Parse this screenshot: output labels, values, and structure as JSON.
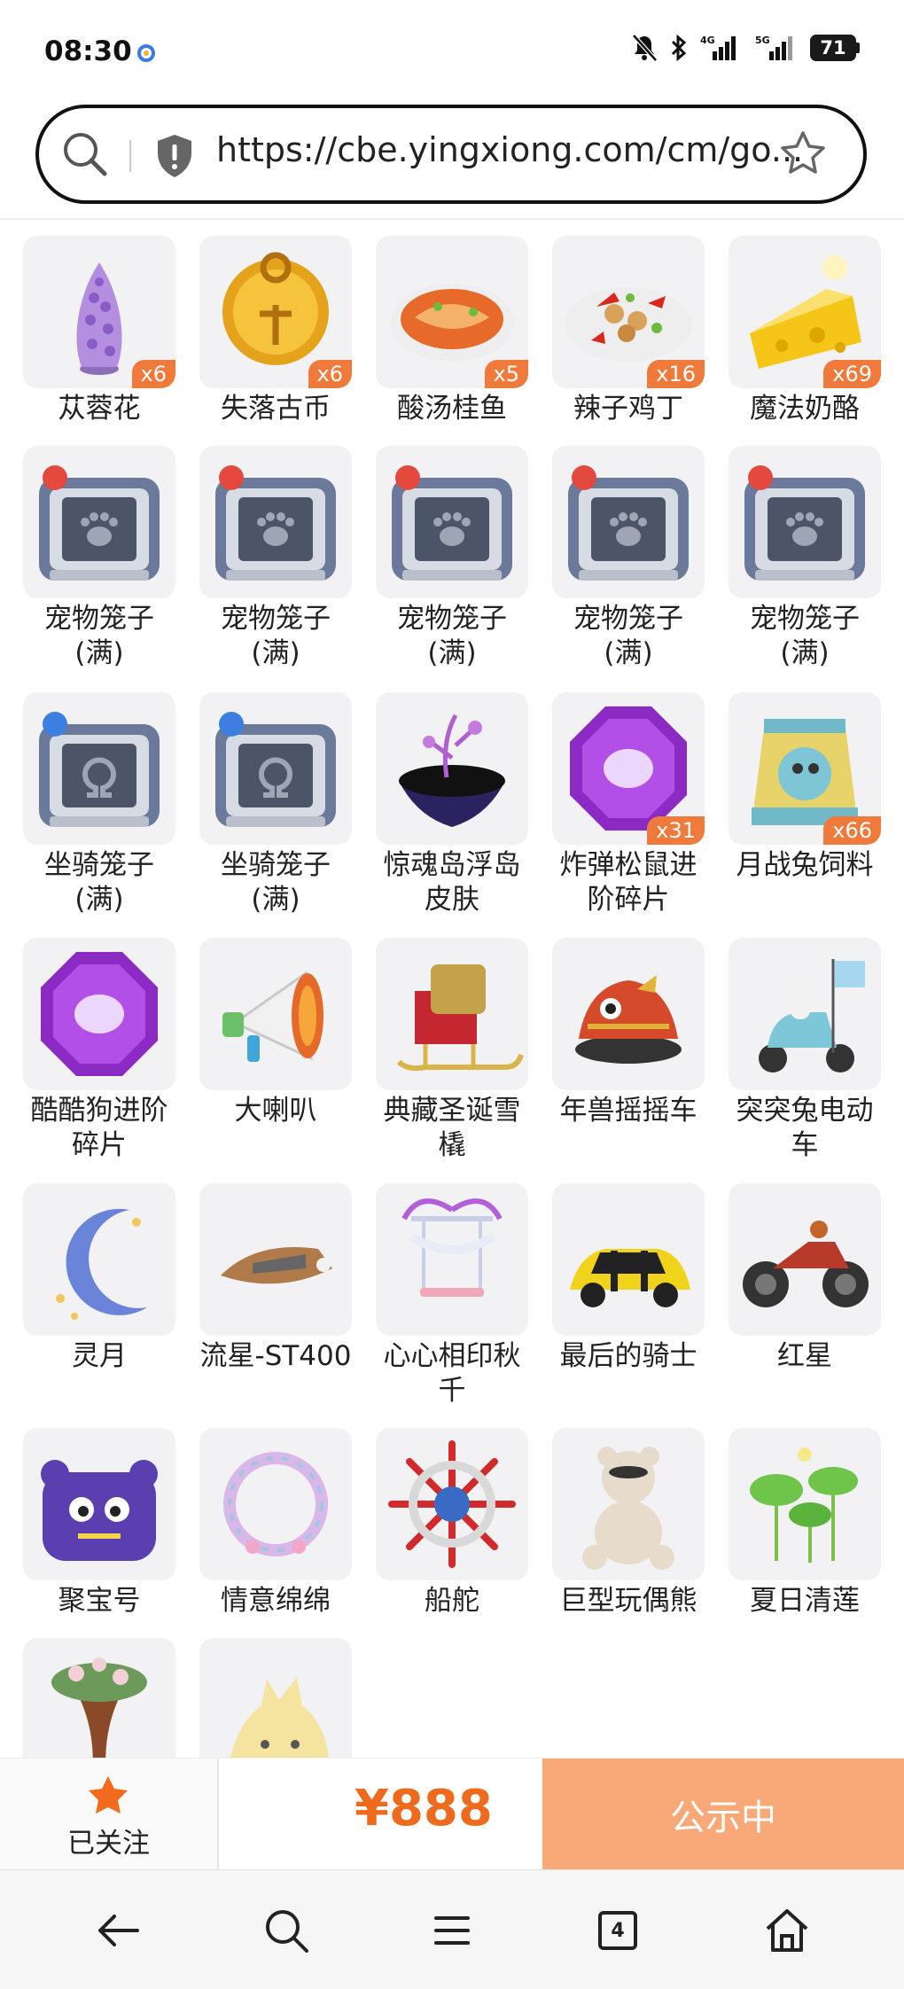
{
  "status_bar": {
    "time": "08:30",
    "battery": "71",
    "network_1": "4G",
    "network_2": "5G"
  },
  "url_bar": {
    "url": "https://cbe.yingxiong.com/cm/go..."
  },
  "items": [
    {
      "name": "苁蓉花",
      "badge": "x6",
      "icon": "flower-icon"
    },
    {
      "name": "失落古币",
      "badge": "x6",
      "icon": "coin-icon"
    },
    {
      "name": "酸汤桂鱼",
      "badge": "x5",
      "icon": "fish-soup-icon"
    },
    {
      "name": "辣子鸡丁",
      "badge": "x16",
      "icon": "chicken-dish-icon"
    },
    {
      "name": "魔法奶酪",
      "badge": "x69",
      "icon": "cheese-icon"
    },
    {
      "name": "宠物笼子\n(满)",
      "badge": "",
      "icon": "pet-cage-icon"
    },
    {
      "name": "宠物笼子\n(满)",
      "badge": "",
      "icon": "pet-cage-icon"
    },
    {
      "name": "宠物笼子\n(满)",
      "badge": "",
      "icon": "pet-cage-icon"
    },
    {
      "name": "宠物笼子\n(满)",
      "badge": "",
      "icon": "pet-cage-icon"
    },
    {
      "name": "宠物笼子\n(满)",
      "badge": "",
      "icon": "pet-cage-icon"
    },
    {
      "name": "坐骑笼子\n(满)",
      "badge": "",
      "icon": "mount-cage-icon"
    },
    {
      "name": "坐骑笼子\n(满)",
      "badge": "",
      "icon": "mount-cage-icon"
    },
    {
      "name": "惊魂岛浮岛\n皮肤",
      "badge": "",
      "icon": "floating-island-icon"
    },
    {
      "name": "炸弹松鼠进\n阶碎片",
      "badge": "x31",
      "icon": "purple-gem-icon"
    },
    {
      "name": "月战兔饲料",
      "badge": "x66",
      "icon": "feed-bag-icon"
    },
    {
      "name": "酷酷狗进阶\n碎片",
      "badge": "",
      "icon": "purple-gem-icon"
    },
    {
      "name": "大喇叭",
      "badge": "",
      "icon": "megaphone-icon"
    },
    {
      "name": "典藏圣诞雪\n橇",
      "badge": "",
      "icon": "sleigh-icon"
    },
    {
      "name": "年兽摇摇车",
      "badge": "",
      "icon": "dragon-car-icon"
    },
    {
      "name": "突突兔电动\n车",
      "badge": "",
      "icon": "scooter-icon"
    },
    {
      "name": "灵月",
      "badge": "",
      "icon": "crescent-moon-icon"
    },
    {
      "name": "流星-ST400",
      "badge": "",
      "icon": "hover-bike-icon"
    },
    {
      "name": "心心相印秋\n千",
      "badge": "",
      "icon": "swing-icon"
    },
    {
      "name": "最后的骑士",
      "badge": "",
      "icon": "yellow-car-icon"
    },
    {
      "name": "红星",
      "badge": "",
      "icon": "motorcycle-icon"
    },
    {
      "name": "聚宝号",
      "badge": "",
      "icon": "purple-monster-icon"
    },
    {
      "name": "情意绵绵",
      "badge": "",
      "icon": "wreath-icon"
    },
    {
      "name": "船舵",
      "badge": "",
      "icon": "ship-wheel-icon"
    },
    {
      "name": "巨型玩偶熊",
      "badge": "",
      "icon": "teddy-bear-icon"
    },
    {
      "name": "夏日清莲",
      "badge": "",
      "icon": "lotus-icon"
    },
    {
      "name": "",
      "badge": "",
      "icon": "flower-vase-icon"
    },
    {
      "name": "",
      "badge": "",
      "icon": "hedgehog-icon"
    }
  ],
  "action_bar": {
    "follow_label": "已关注",
    "price": "¥888",
    "status_label": "公示中"
  },
  "nav": {
    "tab_count": "4"
  },
  "colors": {
    "accent": "#ee6a1d",
    "status_button": "#f9a877",
    "badge": "#f07a3c"
  }
}
